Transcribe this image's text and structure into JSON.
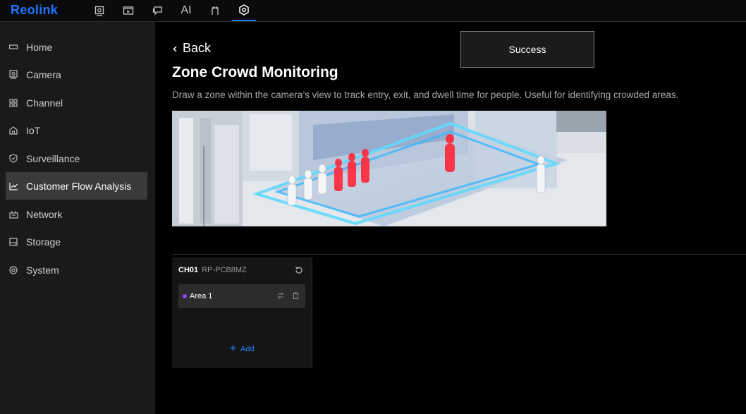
{
  "app": {
    "logo": "Reolink"
  },
  "topnav": {
    "icons": [
      "live-view-icon",
      "playback-icon",
      "messages-icon",
      "ai-icon",
      "tasks-icon",
      "settings-icon"
    ],
    "ai_label": "AI",
    "active": "settings-icon"
  },
  "sidebar": {
    "items": [
      {
        "label": "Home",
        "icon": "home-icon"
      },
      {
        "label": "Camera",
        "icon": "camera-icon"
      },
      {
        "label": "Channel",
        "icon": "channel-icon"
      },
      {
        "label": "IoT",
        "icon": "iot-icon"
      },
      {
        "label": "Surveillance",
        "icon": "shield-icon"
      },
      {
        "label": "Customer Flow Analysis",
        "icon": "chart-icon",
        "active": true
      },
      {
        "label": "Network",
        "icon": "network-icon"
      },
      {
        "label": "Storage",
        "icon": "storage-icon"
      },
      {
        "label": "System",
        "icon": "system-gear-icon"
      }
    ]
  },
  "page": {
    "back_label": "Back",
    "title": "Zone Crowd Monitoring",
    "description": "Draw a zone within the camera’s view to track entry, exit, and dwell time for people. Useful for identifying crowded areas."
  },
  "toast": {
    "message": "Success"
  },
  "channel_card": {
    "channel_id": "CH01",
    "camera_model": "RP-PCB8MZ",
    "areas": [
      {
        "name": "Area 1",
        "color": "#8e44ff"
      }
    ],
    "add_label": "Add"
  },
  "colors": {
    "accent": "#1e74ff",
    "sidebar_bg": "#1a1a1a",
    "active_item_bg": "#3a3a3a"
  }
}
